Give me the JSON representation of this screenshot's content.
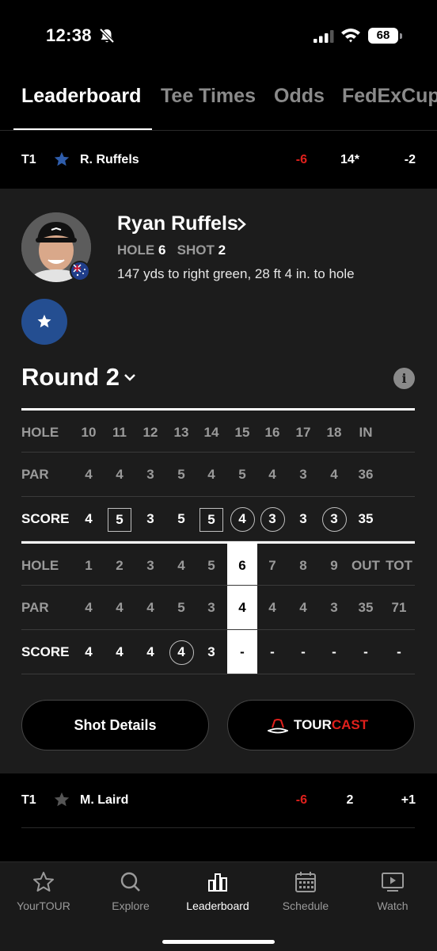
{
  "status": {
    "time": "12:38",
    "battery": "68"
  },
  "tabs": [
    {
      "label": "Leaderboard"
    },
    {
      "label": "Tee Times"
    },
    {
      "label": "Odds"
    },
    {
      "label": "FedExCup"
    }
  ],
  "rows": [
    {
      "pos": "T1",
      "name": "R. Ruffels",
      "total": "-6",
      "thru": "14*",
      "today": "-2",
      "favorite": true
    },
    {
      "pos": "T1",
      "name": "M. Laird",
      "total": "-6",
      "thru": "2",
      "today": "+1",
      "favorite": false
    }
  ],
  "player": {
    "name": "Ryan Ruffels",
    "hole_label": "HOLE",
    "hole": "6",
    "shot_label": "SHOT",
    "shot": "2",
    "shot_desc": "147 yds to right green, 28 ft 4 in. to hole"
  },
  "round": {
    "title": "Round 2",
    "info": "i"
  },
  "back_nine": {
    "hole": [
      "HOLE",
      "10",
      "11",
      "12",
      "13",
      "14",
      "15",
      "16",
      "17",
      "18",
      "IN"
    ],
    "par": [
      "PAR",
      "4",
      "4",
      "3",
      "5",
      "4",
      "5",
      "4",
      "3",
      "4",
      "36"
    ],
    "score": [
      "SCORE",
      "4",
      "5",
      "3",
      "5",
      "5",
      "4",
      "3",
      "3",
      "3",
      "35"
    ]
  },
  "front_nine": {
    "hole": [
      "HOLE",
      "1",
      "2",
      "3",
      "4",
      "5",
      "6",
      "7",
      "8",
      "9",
      "OUT",
      "TOT"
    ],
    "par": [
      "PAR",
      "4",
      "4",
      "4",
      "5",
      "3",
      "4",
      "4",
      "4",
      "3",
      "35",
      "71"
    ],
    "score": [
      "SCORE",
      "4",
      "4",
      "4",
      "4",
      "3",
      "-",
      "-",
      "-",
      "-",
      "-",
      "-"
    ]
  },
  "buttons": {
    "shot_details": "Shot Details",
    "tourcast_a": "TOUR",
    "tourcast_b": "CAST"
  },
  "tabbar": [
    {
      "label": "YourTOUR",
      "icon": "star-icon"
    },
    {
      "label": "Explore",
      "icon": "search-icon"
    },
    {
      "label": "Leaderboard",
      "icon": "bar-chart-icon",
      "active": true
    },
    {
      "label": "Schedule",
      "icon": "calendar-icon"
    },
    {
      "label": "Watch",
      "icon": "play-icon"
    }
  ],
  "colors": {
    "red": "#e0201c",
    "blue": "#244e91"
  }
}
